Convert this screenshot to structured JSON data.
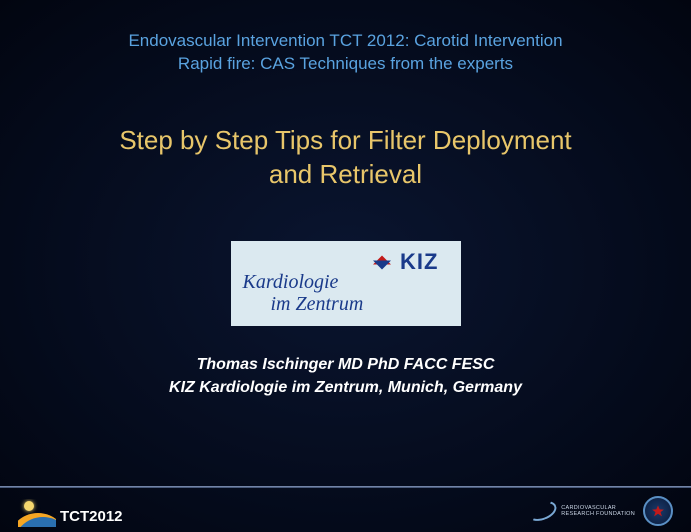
{
  "header": {
    "line1": "Endovascular Intervention TCT 2012: Carotid Intervention",
    "line2": "Rapid fire: CAS Techniques from the experts"
  },
  "title": {
    "line1": "Step by Step Tips for Filter Deployment",
    "line2": "and Retrieval"
  },
  "logo": {
    "kiz": "KIZ",
    "line1": "Kardiologie",
    "line2": "im Zentrum"
  },
  "author": {
    "line1": "Thomas Ischinger  MD PhD FACC FESC",
    "line2": "KIZ  Kardiologie im Zentrum, Munich, Germany"
  },
  "footer": {
    "tct": "TCT2012",
    "crf_line1": "CARDIOVASCULAR",
    "crf_line2": "RESEARCH FOUNDATION"
  }
}
